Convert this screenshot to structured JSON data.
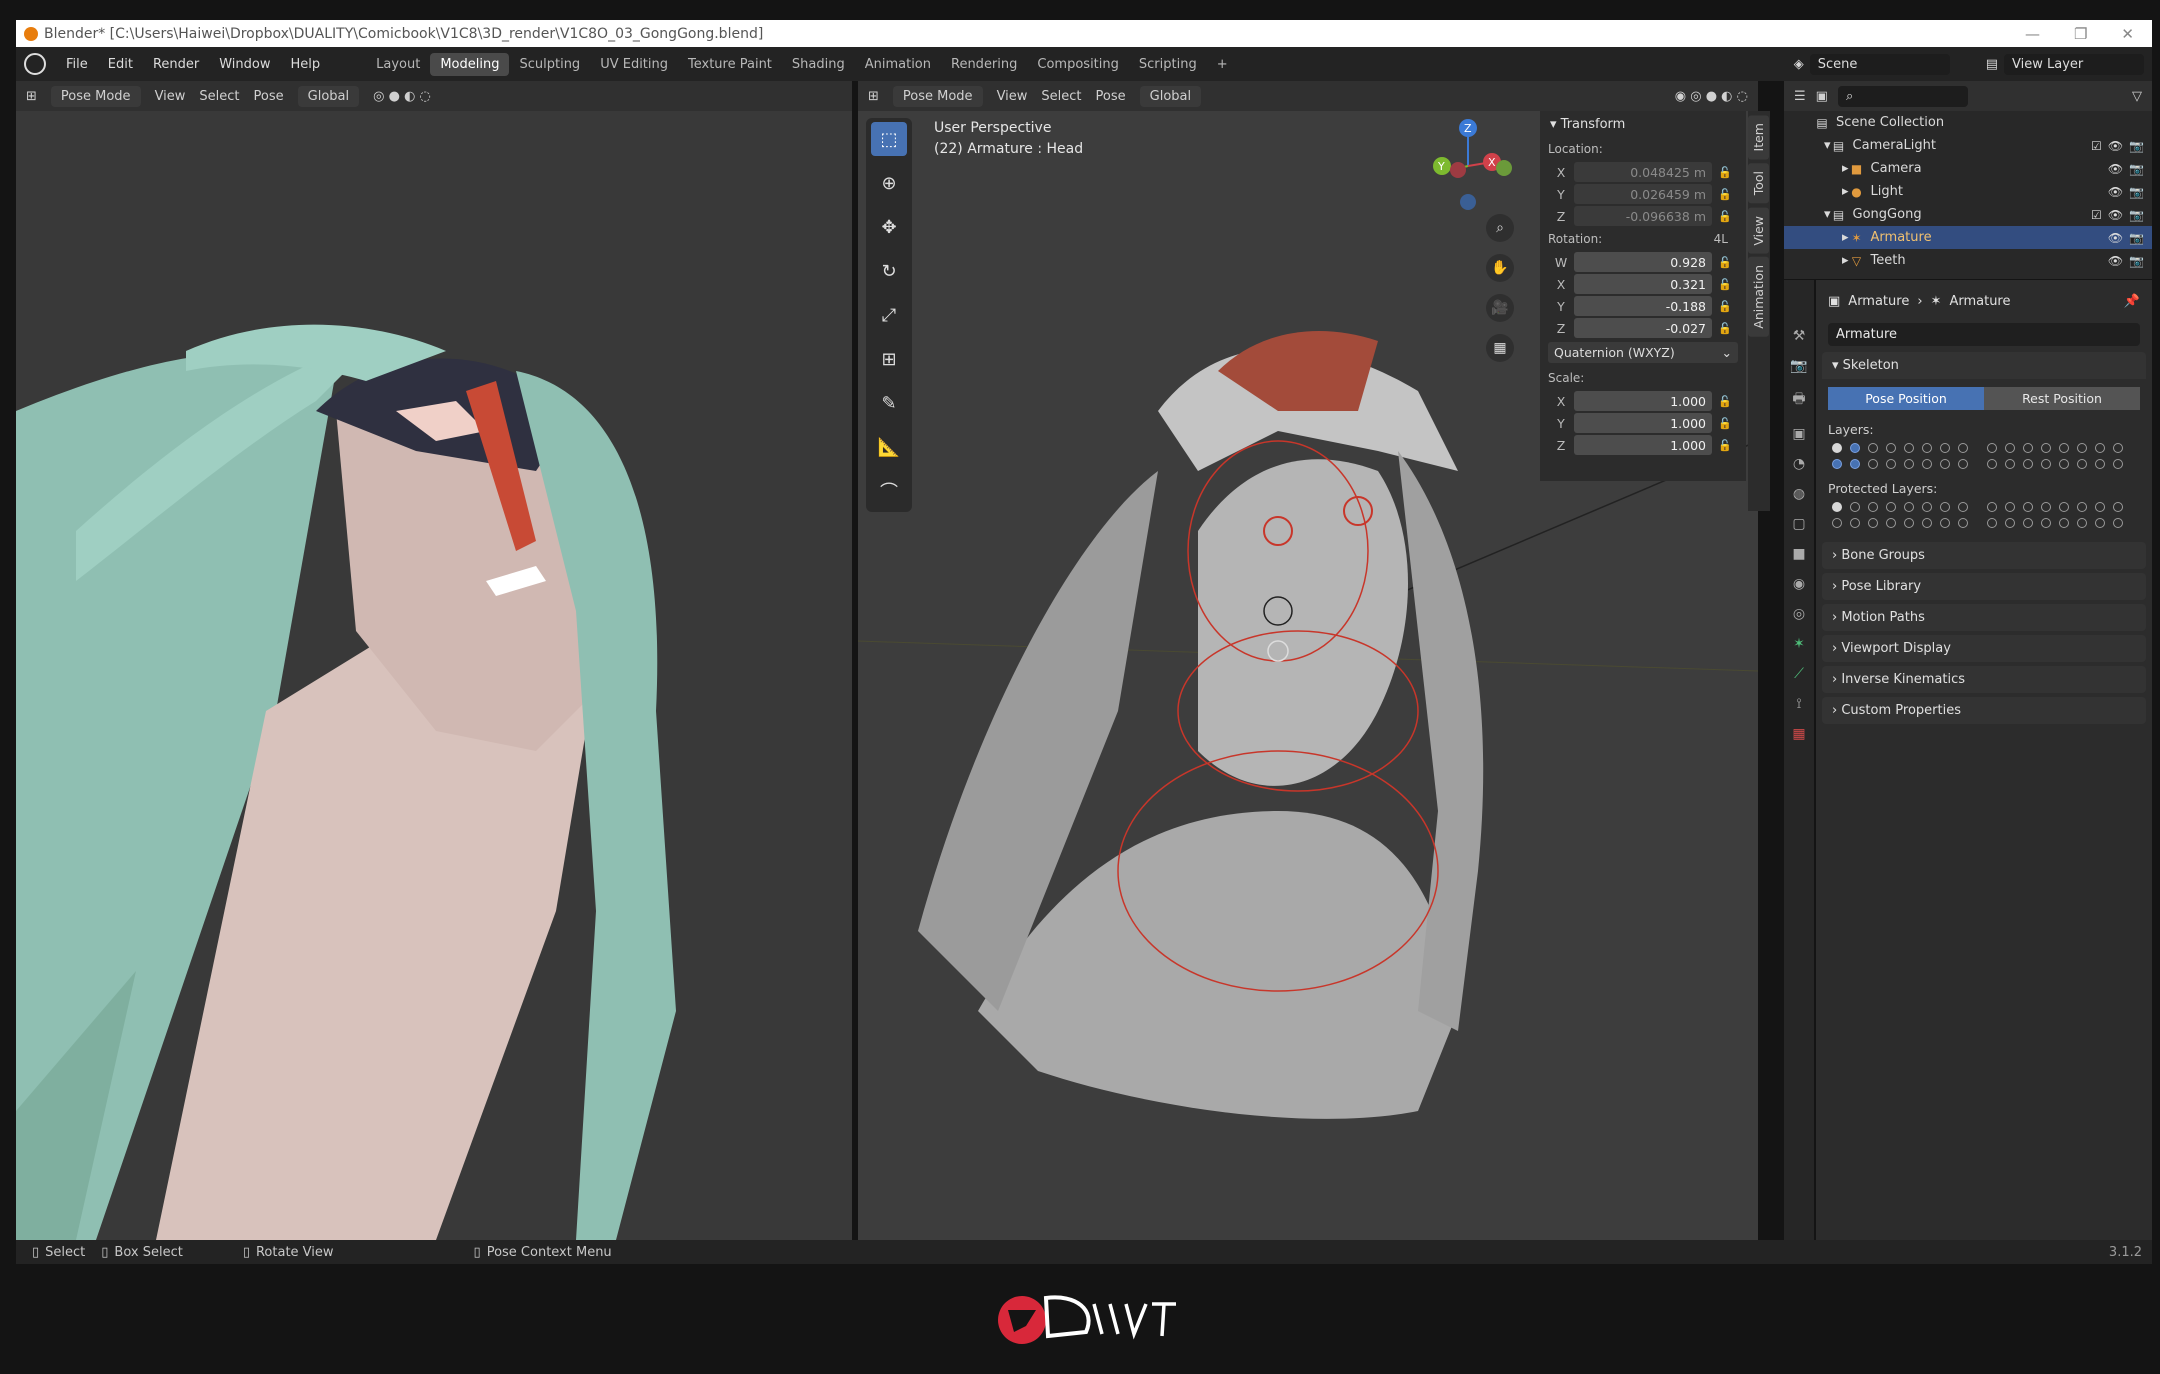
{
  "window": {
    "title": "Blender* [C:\\Users\\Haiwei\\Dropbox\\DUALITY\\Comicbook\\V1C8\\3D_render\\V1C8O_03_GongGong.blend]"
  },
  "menu": [
    "File",
    "Edit",
    "Render",
    "Window",
    "Help"
  ],
  "workspaces": [
    "Layout",
    "Modeling",
    "Sculpting",
    "UV Editing",
    "Texture Paint",
    "Shading",
    "Animation",
    "Rendering",
    "Compositing",
    "Scripting"
  ],
  "scene": "Scene",
  "view_layer": "View Layer",
  "header_left": {
    "mode": "Pose Mode",
    "items": [
      "View",
      "Select",
      "Pose"
    ],
    "orient": "Global"
  },
  "header_right": {
    "mode": "Pose Mode",
    "items": [
      "View",
      "Select",
      "Pose"
    ],
    "orient": "Global"
  },
  "viewport": {
    "perspective": "User Perspective",
    "object": "(22) Armature : Head"
  },
  "transform": {
    "title": "Transform",
    "location_label": "Location:",
    "location": [
      {
        "k": "X",
        "v": "0.048425 m"
      },
      {
        "k": "Y",
        "v": "0.026459 m"
      },
      {
        "k": "Z",
        "v": "-0.096638 m"
      }
    ],
    "rotation_label": "Rotation:",
    "rotation_extra": "4L",
    "rotation": [
      {
        "k": "W",
        "v": "0.928"
      },
      {
        "k": "X",
        "v": "0.321"
      },
      {
        "k": "Y",
        "v": "-0.188"
      },
      {
        "k": "Z",
        "v": "-0.027"
      }
    ],
    "rot_mode": "Quaternion (WXYZ)",
    "scale_label": "Scale:",
    "scale": [
      {
        "k": "X",
        "v": "1.000"
      },
      {
        "k": "Y",
        "v": "1.000"
      },
      {
        "k": "Z",
        "v": "1.000"
      }
    ]
  },
  "sidetabs": [
    "Item",
    "Tool",
    "View",
    "Animation"
  ],
  "outliner": [
    {
      "name": "Scene Collection",
      "indent": 0
    },
    {
      "name": "CameraLight",
      "indent": 1
    },
    {
      "name": "Camera",
      "indent": 2
    },
    {
      "name": "Light",
      "indent": 2
    },
    {
      "name": "GongGong",
      "indent": 1
    },
    {
      "name": "Armature",
      "indent": 2,
      "selected": true
    },
    {
      "name": "Teeth",
      "indent": 2
    }
  ],
  "properties": {
    "crumb_a": "Armature",
    "crumb_b": "Armature",
    "name": "Armature",
    "skeleton": "Skeleton",
    "pose_position": "Pose Position",
    "rest_position": "Rest Position",
    "layers": "Layers:",
    "protected_layers": "Protected Layers:",
    "panels": [
      "Bone Groups",
      "Pose Library",
      "Motion Paths",
      "Viewport Display",
      "Inverse Kinematics",
      "Custom Properties"
    ]
  },
  "status": {
    "select": "Select",
    "box_select": "Box Select",
    "rotate": "Rotate View",
    "context": "Pose Context Menu",
    "version": "3.1.2"
  },
  "colors": {
    "accent": "#4772b3",
    "title_bg": "#ffffff",
    "logo_red": "#d8283a"
  }
}
